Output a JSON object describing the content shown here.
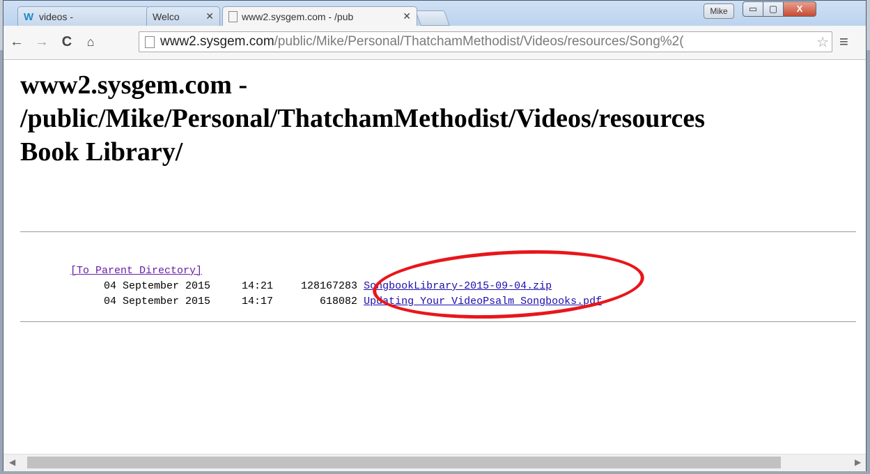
{
  "profile_name": "Mike",
  "window_controls": {
    "minimize": "▭",
    "maximize": "▢",
    "close": "X"
  },
  "tabs": [
    {
      "title": "videos -",
      "icon": "wix-icon"
    },
    {
      "title": "Welco",
      "icon": "none"
    },
    {
      "title": "www2.sysgem.com - /pub",
      "icon": "page-icon"
    }
  ],
  "toolbar": {
    "back": "←",
    "forward": "→",
    "reload": "C",
    "home": "🏠",
    "url_host": "www2.sysgem.com",
    "url_path": "/public/Mike/Personal/ThatchamMethodist/Videos/resources/Song%2(",
    "star": "☆",
    "menu": "≡"
  },
  "page": {
    "heading": "www2.sysgem.com -\n/public/Mike/Personal/ThatchamMethodist/Videos/resources\nBook Library/",
    "parent_link": "[To Parent Directory]",
    "files": [
      {
        "date": "04 September 2015",
        "time": "14:21",
        "size": "128167283",
        "name": "SongbookLibrary-2015-09-04.zip"
      },
      {
        "date": "04 September 2015",
        "time": "14:17",
        "size": "618082",
        "name": "Updating Your VideoPsalm Songbooks.pdf"
      }
    ]
  },
  "annotation_color": "#e8161b"
}
